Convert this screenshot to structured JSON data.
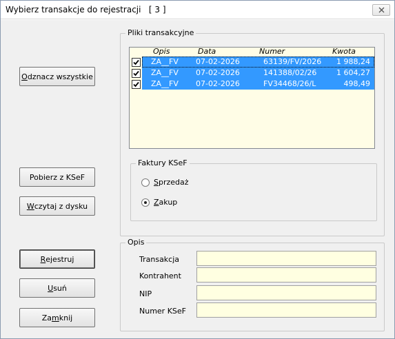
{
  "window": {
    "title": "Wybierz transakcje do rejestracji   [ 3 ]",
    "close_icon": "close-icon"
  },
  "buttons": {
    "deselect_all": {
      "pre": "",
      "accel": "O",
      "post": "dznacz wszystkie"
    },
    "fetch_ksef": {
      "label": "Pobierz z KSeF"
    },
    "load_disk": {
      "pre": "",
      "accel": "W",
      "post": "czytaj z dysku"
    },
    "register": {
      "pre": "",
      "accel": "R",
      "post": "ejestruj"
    },
    "delete": {
      "pre": "",
      "accel": "U",
      "post": "suń"
    },
    "close": {
      "pre": "Za",
      "accel": "m",
      "post": "knij"
    }
  },
  "files_group": {
    "title": "Pliki transakcyjne",
    "columns": [
      "Opis",
      "Data",
      "Numer",
      "Kwota"
    ],
    "rows": [
      {
        "checked": true,
        "opis": "ZA__FV",
        "data": "07-02-2026",
        "numer": "63139/FV/2026",
        "kwota": "1 988,24"
      },
      {
        "checked": true,
        "opis": "ZA__FV",
        "data": "07-02-2026",
        "numer": "141388/02/26",
        "kwota": "1 604,27"
      },
      {
        "checked": true,
        "opis": "ZA__FV",
        "data": "07-02-2026",
        "numer": "FV34468/26/L",
        "kwota": "498,49"
      }
    ]
  },
  "ksef_group": {
    "title": "Faktury KSeF",
    "options": [
      {
        "accel": "S",
        "rest": "przedaż",
        "selected": false
      },
      {
        "accel": "Z",
        "rest": "akup",
        "selected": true
      }
    ]
  },
  "desc_group": {
    "title": "Opis",
    "fields": [
      {
        "label": "Transakcja",
        "value": ""
      },
      {
        "label": "Kontrahent",
        "value": ""
      },
      {
        "label": "NIP",
        "value": ""
      },
      {
        "label": "Numer KSeF",
        "value": ""
      }
    ]
  },
  "colors": {
    "selection": "#3399ff",
    "list_background": "#fffde6",
    "input_background": "#ffffe1",
    "dialog_background": "#f0f0f0"
  }
}
